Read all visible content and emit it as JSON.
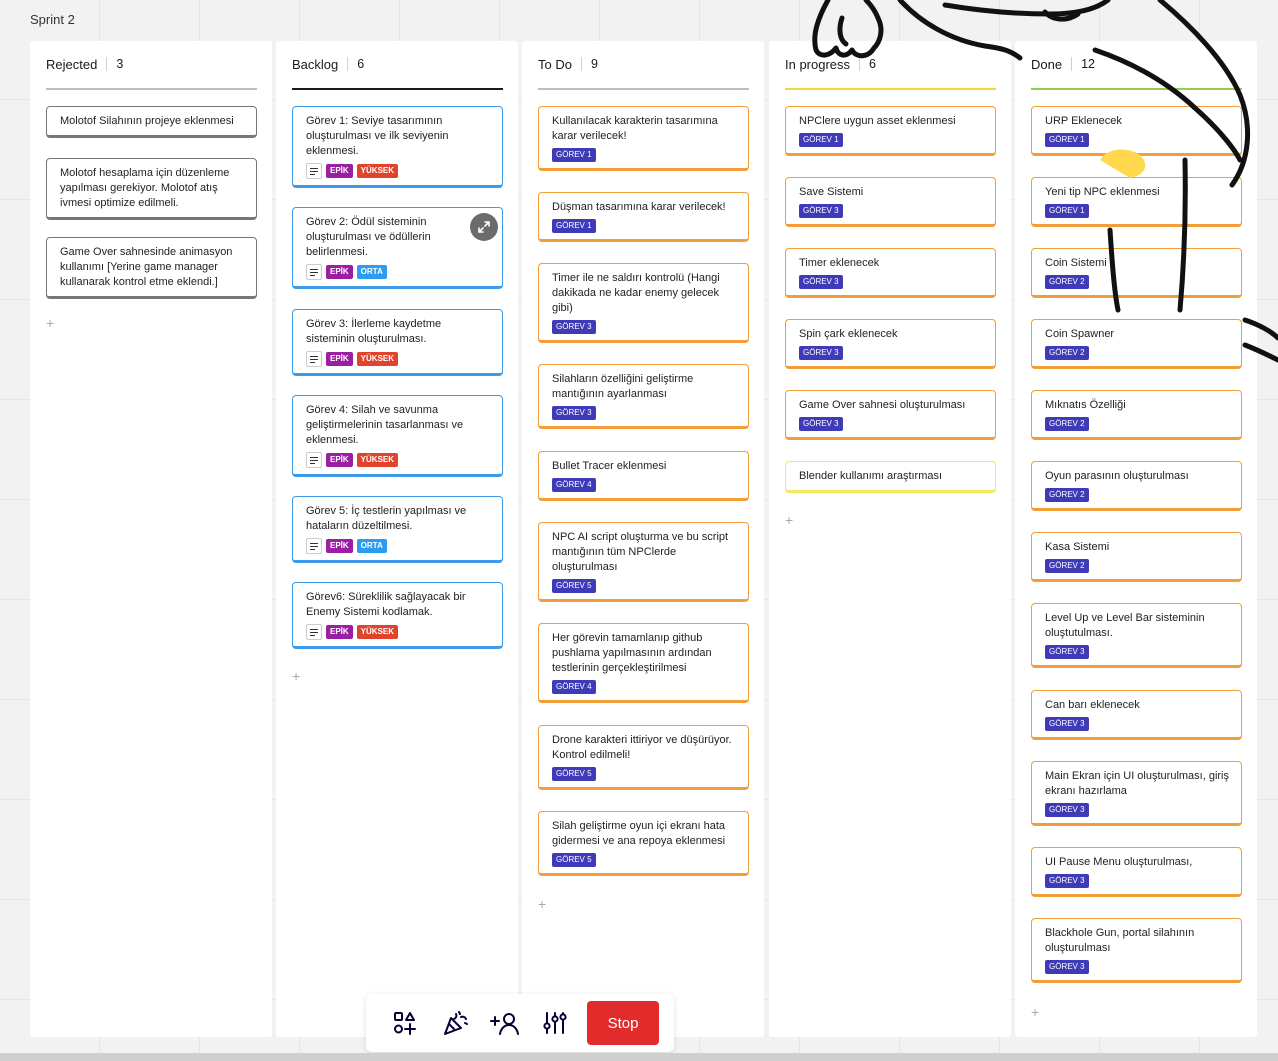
{
  "frame_title": "Sprint 2",
  "colors": {
    "rejected_line": "#bdbdbd",
    "backlog_line": "#1a1a1a",
    "todo_line": "#bdbdbd",
    "inprogress_line": "#f2d63a",
    "done_line": "#8fd14f",
    "tag_epik": "#9b1fa3",
    "tag_yuksek": "#e0442c",
    "tag_orta": "#2d9bf0",
    "tag_gorev": "#3f3bb8",
    "stop_button": "#e22c2c"
  },
  "columns": [
    {
      "title": "Rejected",
      "count": "3",
      "cards": [
        {
          "text": "Molotof Silahının projeye eklenmesi"
        },
        {
          "text": "Molotof hesaplama için düzenleme yapılması gerekiyor. Molotof atış ivmesi optimize edilmeli."
        },
        {
          "text": "Game Over sahnesinde animasyon kullanımı [Yerine game manager kullanarak kontrol etme eklendi.]"
        }
      ]
    },
    {
      "title": "Backlog",
      "count": "6",
      "cards": [
        {
          "text": "Görev 1: Seviye tasarımının oluşturulması ve ilk seviyenin eklenmesi.",
          "tag1": "EPİK",
          "tag2": "YÜKSEK"
        },
        {
          "text": "Görev 2: Ödül sisteminin oluşturulması ve ödüllerin belirlenmesi.",
          "tag1": "EPİK",
          "tag2": "ORTA"
        },
        {
          "text": "Görev 3: İlerleme kaydetme sisteminin oluşturulması.",
          "tag1": "EPİK",
          "tag2": "YÜKSEK"
        },
        {
          "text": "Görev 4: Silah ve savunma geliştirmelerinin tasarlanması ve eklenmesi.",
          "tag1": "EPİK",
          "tag2": "YÜKSEK"
        },
        {
          "text": "Görev 5: İç testlerin yapılması ve hataların düzeltilmesi.",
          "tag1": "EPİK",
          "tag2": "ORTA"
        },
        {
          "text": "Görev6: Süreklilik sağlayacak bir Enemy Sistemi kodlamak.",
          "tag1": "EPİK",
          "tag2": "YÜKSEK"
        }
      ]
    },
    {
      "title": "To Do",
      "count": "9",
      "cards": [
        {
          "text": "Kullanılacak karakterin tasarımına karar verilecek!",
          "tag": "GÖREV 1"
        },
        {
          "text": "Düşman tasarımına karar verilecek!",
          "tag": "GÖREV 1"
        },
        {
          "text": "Timer ile ne saldırı kontrolü (Hangi dakikada ne kadar enemy gelecek gibi)",
          "tag": "GÖREV 3"
        },
        {
          "text": "Silahların özelliğini geliştirme mantığının ayarlanması",
          "tag": "GÖREV 3"
        },
        {
          "text": "Bullet Tracer eklenmesi",
          "tag": "GÖREV 4"
        },
        {
          "text": "NPC AI script oluşturma ve bu script mantığının tüm NPClerde oluşturulması",
          "tag": "GÖREV 5"
        },
        {
          "text": "Her görevin tamamlanıp github pushlama yapılmasının ardından testlerinin gerçekleştirilmesi",
          "tag": "GÖREV 4"
        },
        {
          "text": "Drone karakteri ittiriyor ve düşürüyor. Kontrol edilmeli!",
          "tag": "GÖREV 5"
        },
        {
          "text": "Silah geliştirme oyun içi ekranı hata gidermesi ve ana repoya eklenmesi",
          "tag": "GÖREV 5"
        }
      ]
    },
    {
      "title": "In progress",
      "count": "6",
      "cards": [
        {
          "text": "NPClere uygun asset eklenmesi",
          "tag": "GÖREV 1"
        },
        {
          "text": "Save Sistemi",
          "tag": "GÖREV 3"
        },
        {
          "text": "Timer eklenecek",
          "tag": "GÖREV 3"
        },
        {
          "text": "Spin çark eklenecek",
          "tag": "GÖREV 3"
        },
        {
          "text": "Game Over sahnesi oluşturulması",
          "tag": "GÖREV 3"
        },
        {
          "text": "Blender kullanımı araştırması"
        }
      ]
    },
    {
      "title": "Done",
      "count": "12",
      "cards": [
        {
          "text": "URP Eklenecek",
          "tag": "GÖREV 1"
        },
        {
          "text": "Yeni tip NPC eklenmesi",
          "tag": "GÖREV 1"
        },
        {
          "text": "Coin Sistemi",
          "tag": "GÖREV 2"
        },
        {
          "text": "Coin Spawner",
          "tag": "GÖREV 2"
        },
        {
          "text": "Mıknatıs Özelliği",
          "tag": "GÖREV 2"
        },
        {
          "text": "Oyun parasının oluşturulması",
          "tag": "GÖREV 2"
        },
        {
          "text": "Kasa Sistemi",
          "tag": "GÖREV 2"
        },
        {
          "text": "Level Up ve Level Bar sisteminin oluştutulması.",
          "tag": "GÖREV 3"
        },
        {
          "text": "Can barı eklenecek",
          "tag": "GÖREV 3"
        },
        {
          "text": "Main Ekran için UI oluşturulması, giriş ekranı hazırlama",
          "tag": "GÖREV 3"
        },
        {
          "text": "UI Pause Menu oluşturulması,",
          "tag": "GÖREV 3"
        },
        {
          "text": "Blackhole Gun, portal silahının oluşturulması",
          "tag": "GÖREV 3"
        }
      ]
    }
  ],
  "toolbar": {
    "tools": [
      "shapes-icon",
      "celebrate-icon",
      "add-user-icon",
      "settings-sliders-icon"
    ],
    "stop_label": "Stop"
  }
}
